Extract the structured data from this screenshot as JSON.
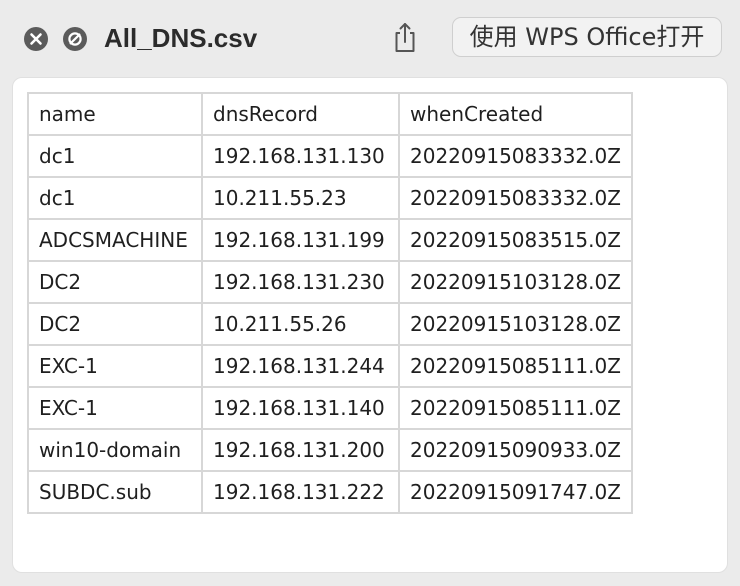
{
  "window": {
    "filename": "All_DNS.csv",
    "open_with_label": "使用 WPS Office打开"
  },
  "icons": {
    "close": "close-icon",
    "hide": "hide-icon",
    "share": "share-icon"
  },
  "colors": {
    "titlebar_bg": "#ebebeb",
    "content_bg": "#ffffff",
    "grid_border": "#d7d7d7",
    "button_icon": "#5b5b5b"
  },
  "table": {
    "headers": [
      "name",
      "dnsRecord",
      "whenCreated"
    ],
    "rows": [
      [
        "dc1",
        "192.168.131.130",
        "20220915083332.0Z"
      ],
      [
        "dc1",
        "10.211.55.23",
        "20220915083332.0Z"
      ],
      [
        "ADCSMACHINE",
        "192.168.131.199",
        "20220915083515.0Z"
      ],
      [
        "DC2",
        "192.168.131.230",
        "20220915103128.0Z"
      ],
      [
        "DC2",
        "10.211.55.26",
        "20220915103128.0Z"
      ],
      [
        "EXC-1",
        "192.168.131.244",
        "20220915085111.0Z"
      ],
      [
        "EXC-1",
        "192.168.131.140",
        "20220915085111.0Z"
      ],
      [
        "win10-domain",
        "192.168.131.200",
        "20220915090933.0Z"
      ],
      [
        "SUBDC.sub",
        "192.168.131.222",
        "20220915091747.0Z"
      ]
    ]
  }
}
